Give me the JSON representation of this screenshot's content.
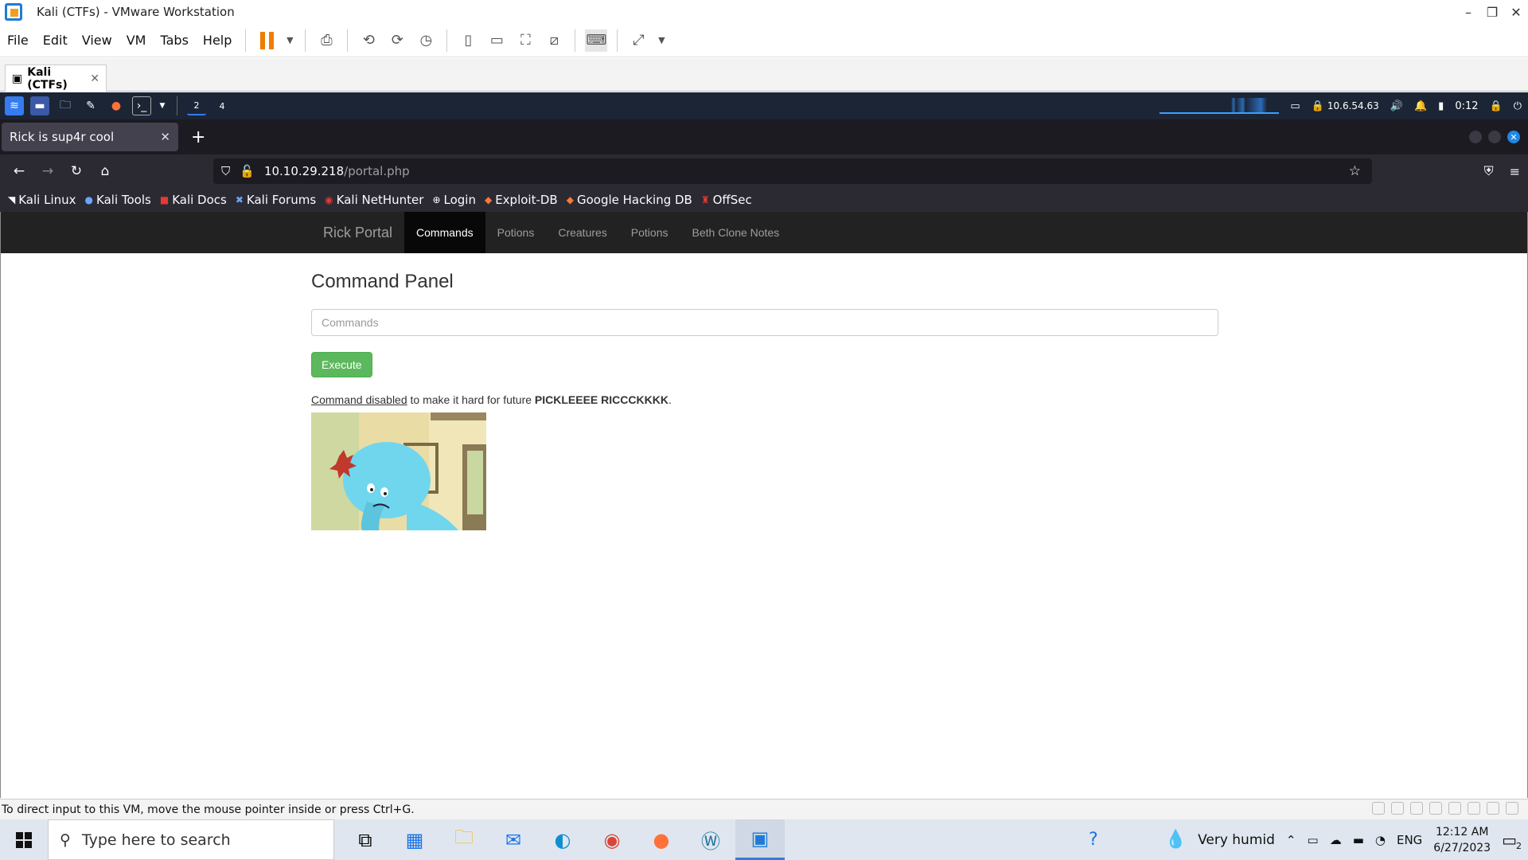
{
  "vmware": {
    "title": "Kali (CTFs) - VMware Workstation",
    "menu": [
      "File",
      "Edit",
      "View",
      "VM",
      "Tabs",
      "Help"
    ],
    "tab_label": "Kali (CTFs)",
    "status_text": "To direct input to this VM, move the mouse pointer inside or press Ctrl+G."
  },
  "kali_panel": {
    "workspace_badge": "2",
    "terminal_badge": "4",
    "ip": "10.6.54.63",
    "time": "0:12"
  },
  "browser": {
    "tab_title": "Rick is sup4r cool",
    "url_host": "10.10.29.218",
    "url_path": "/portal.php",
    "bookmarks": [
      "Kali Linux",
      "Kali Tools",
      "Kali Docs",
      "Kali Forums",
      "Kali NetHunter",
      "Login",
      "Exploit-DB",
      "Google Hacking DB",
      "OffSec"
    ]
  },
  "site": {
    "brand": "Rick Portal",
    "nav": [
      "Commands",
      "Potions",
      "Creatures",
      "Potions",
      "Beth Clone Notes"
    ],
    "active_nav": "Commands",
    "heading": "Command Panel",
    "input_placeholder": "Commands",
    "execute_label": "Execute",
    "msg_link": "Command disabled",
    "msg_text": " to make it hard for future ",
    "msg_bold": "PICKLEEEE RICCCKKKK",
    "msg_end": "."
  },
  "taskbar": {
    "search_placeholder": "Type here to search",
    "weather": "Very humid",
    "lang": "ENG",
    "time": "12:12 AM",
    "date": "6/27/2023",
    "notif_count": "2"
  },
  "colors": {
    "execute_button": "#5cb85c",
    "site_nav_bg": "#222222",
    "kali_panel_bg": "#1c2535"
  }
}
